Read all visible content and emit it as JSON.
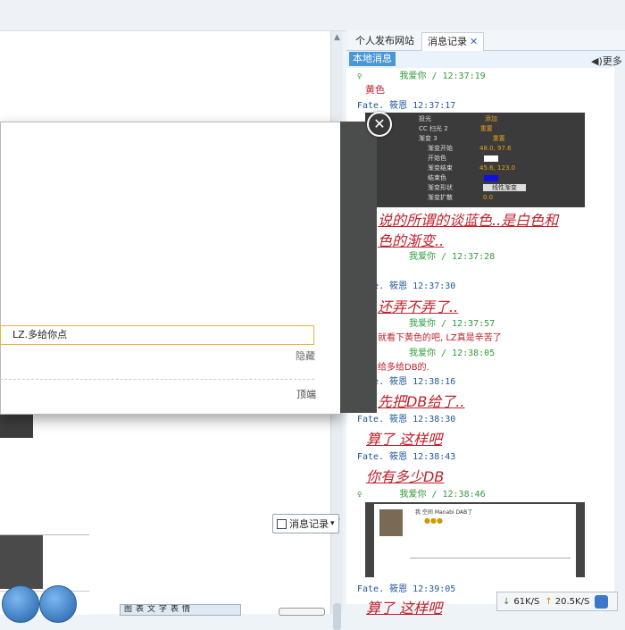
{
  "tabs": [
    {
      "label": "个人发布网站"
    },
    {
      "label": "消息记录",
      "close": "✕"
    }
  ],
  "local_badge": "本地消息",
  "speaker_text": "更多",
  "history_button": "消息记录",
  "modal": {
    "close": "✕",
    "input_value": "LZ.多给你点",
    "hide_label": "隐藏",
    "top_label": "顶端"
  },
  "toolbar_glyphs": "图表文字表情",
  "messages": [
    {
      "head": "我爱你 / 12:37:19",
      "color": "green",
      "text": "黄色"
    },
    {
      "head": "Fate.  筱恩 12:37:17",
      "color": "blue"
    },
    {
      "text_big_1": "说的所谓的谈蓝色..是白色和",
      "text_big_2": "色的渐变.."
    },
    {
      "head": "我爱你 / 12:37:28",
      "color": "green"
    },
    {
      "head": "Fate.  筱恩 12:37:30",
      "color": "blue",
      "text_big": "还弄不弄了.."
    },
    {
      "head": "我爱你 / 12:37:57",
      "color": "green",
      "text": "就看下黄色的吧, LZ真是辛苦了"
    },
    {
      "head": "我爱你 / 12:38:05",
      "color": "green",
      "text": "给多给DB的."
    },
    {
      "head": "Fate.  筱恩 12:38:16",
      "color": "blue",
      "text_big": "先把DB给了.."
    },
    {
      "head": "Fate.  筱恩 12:38:30",
      "color": "blue",
      "text_big": "算了 这样吧"
    },
    {
      "head": "Fate.  筱恩 12:38:43",
      "color": "blue",
      "text_big": "你有多少DB"
    },
    {
      "head": "我爱你 / 12:38:46",
      "color": "green"
    },
    {
      "head": "Fate.  筱恩 12:39:05",
      "color": "blue",
      "text_big": "算了 这样吧"
    }
  ],
  "image1_rows": [
    {
      "label": "投光",
      "value": "添加"
    },
    {
      "label": "CC 扫光   2",
      "value": "重置"
    },
    {
      "label": "渐变 3",
      "value": "重置"
    },
    {
      "label": "渐变开始",
      "value": "48.0, 97.6"
    },
    {
      "label": "开始色",
      "value": ""
    },
    {
      "label": "渐变结束",
      "value": "45.6, 123.0"
    },
    {
      "label": "结束色",
      "value": ""
    },
    {
      "label": "渐变形状",
      "value": "线性渐变"
    },
    {
      "label": "渐变扩散",
      "value": "0.0"
    }
  ],
  "image2_text": "我 空间   Manabi DAB了",
  "net": {
    "down": "61K/S",
    "up": "20.5K/S",
    "down_arrow": "↓",
    "up_arrow": "↑"
  }
}
